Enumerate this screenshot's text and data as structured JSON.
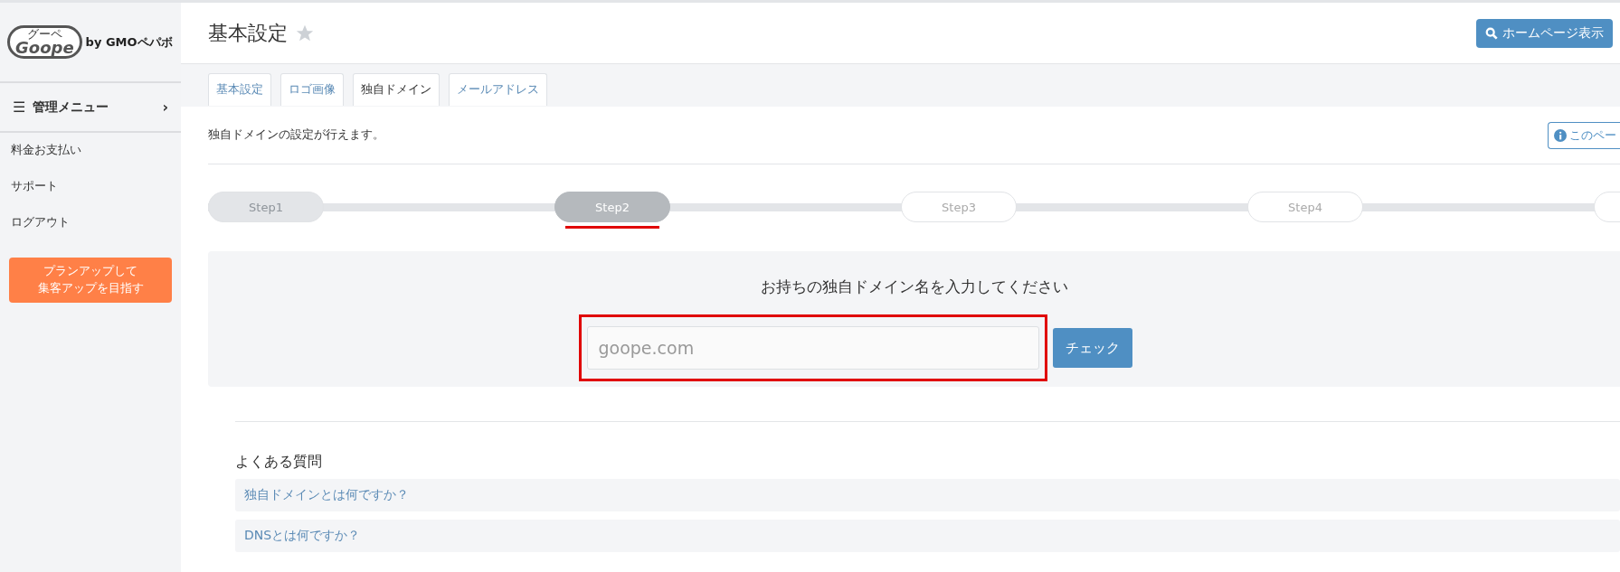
{
  "logo": {
    "kana": "グーペ",
    "wordmark": "Goope",
    "byline": "by GMOペパボ"
  },
  "sidebar": {
    "menu_header": {
      "icon": "☰",
      "label": "管理メニュー",
      "caret": "›"
    },
    "items": [
      {
        "label": "料金お支払い"
      },
      {
        "label": "サポート"
      },
      {
        "label": "ログアウト"
      }
    ],
    "promo_button": {
      "lines": [
        "プランアップして",
        "集客アップを目指す"
      ]
    }
  },
  "header": {
    "title": "基本設定",
    "favorite": false,
    "homepage_button": "ホームページ表示"
  },
  "tabs": [
    {
      "label": "基本設定",
      "selected": false
    },
    {
      "label": "ロゴ画像",
      "selected": false
    },
    {
      "label": "独自ドメイン",
      "selected": true
    },
    {
      "label": "メールアドレス",
      "selected": false
    }
  ],
  "description": "独自ドメインの設定が行えます。",
  "help_button": "このペー",
  "steps": [
    {
      "label": "Step1",
      "completed": true,
      "selected": false,
      "highlighted": false
    },
    {
      "label": "Step2",
      "completed": false,
      "selected": true,
      "highlighted": true
    },
    {
      "label": "Step3",
      "completed": false,
      "selected": false,
      "highlighted": false
    },
    {
      "label": "Step4",
      "completed": false,
      "selected": false,
      "highlighted": false
    },
    {
      "completed": false,
      "selected": false,
      "highlighted": false
    }
  ],
  "domain_form": {
    "heading": "お持ちの独自ドメイン名を入力してください",
    "placeholder": "goope.com",
    "highlighted": true,
    "check_button": "チェック"
  },
  "faq": {
    "title": "よくある質問",
    "items": [
      "独自ドメインとは何ですか？",
      "DNSとは何ですか？"
    ]
  }
}
